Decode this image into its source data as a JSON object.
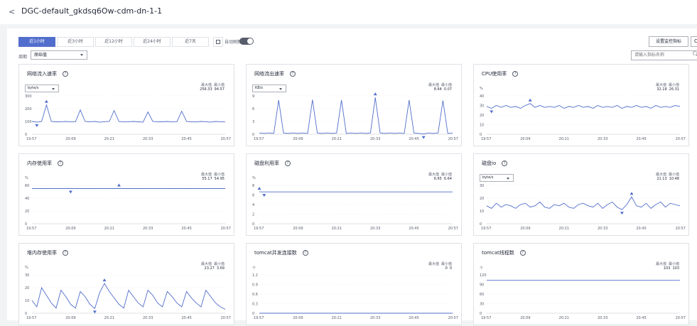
{
  "header": {
    "back": "<",
    "title": "DGC-default_gkdsq6Ow-cdm-dn-1-1"
  },
  "toolbar": {
    "tabs": [
      "近1小时",
      "近3小时",
      "近12小时",
      "近24小时",
      "近7天"
    ],
    "active_tab": 0,
    "auto_refresh_label": "自动刷新",
    "auto_refresh_on": false,
    "settings_label": "设置监控指标",
    "edge_label": "C",
    "period_label": "周期",
    "period_value": "原始值",
    "search_placeholder": "请输入指标名称"
  },
  "cards": [
    {
      "title": "网络流入速率",
      "unit_select": "byte/s",
      "unit_text": "",
      "max_label": "最大值",
      "min_label": "最小值",
      "max": "256.33",
      "min": "94.57"
    },
    {
      "title": "网络流出速率",
      "unit_select": "KB/s",
      "unit_text": "",
      "max_label": "最大值",
      "min_label": "最小值",
      "max": "8.64",
      "min": "0.07"
    },
    {
      "title": "CPU使用率",
      "unit_select": "",
      "unit_text": "%",
      "max_label": "最大值",
      "min_label": "最小值",
      "max": "32.18",
      "min": "26.31"
    },
    {
      "title": "内存使用率",
      "unit_select": "",
      "unit_text": "%",
      "max_label": "最大值",
      "min_label": "最小值",
      "max": "55.17",
      "min": "54.95"
    },
    {
      "title": "磁盘利用率",
      "unit_select": "",
      "unit_text": "%",
      "max_label": "最大值",
      "min_label": "最小值",
      "max": "6.65",
      "min": "6.64"
    },
    {
      "title": "磁盘io",
      "unit_select": "byte/s",
      "unit_text": "",
      "max_label": "最大值",
      "min_label": "最小值",
      "max": "21.13",
      "min": "10.48"
    },
    {
      "title": "堆内存使用率",
      "unit_select": "",
      "unit_text": "%",
      "max_label": "最大值",
      "min_label": "最小值",
      "max": "23.27",
      "min": "3.69"
    },
    {
      "title": "tomcat并发连接数",
      "unit_select": "",
      "unit_text": "个",
      "max_label": "最大值",
      "min_label": "最小值",
      "max": "0",
      "min": "0"
    },
    {
      "title": "tomcat线程数",
      "unit_select": "",
      "unit_text": "个",
      "max_label": "最大值",
      "min_label": "最小值",
      "max": "103",
      "min": "103"
    }
  ],
  "chart_data": [
    {
      "type": "line",
      "title": "网络流入速率",
      "x": [
        "19:57",
        "20:09",
        "20:21",
        "20:33",
        "20:45",
        "20:57"
      ],
      "yticks": [
        0,
        100,
        200,
        300
      ],
      "ylim": [
        0,
        300
      ],
      "values": [
        100,
        95,
        100,
        230,
        100,
        97,
        98,
        100,
        96,
        98,
        190,
        100,
        97,
        100,
        95,
        98,
        100,
        185,
        100,
        96,
        98,
        100,
        97,
        95,
        175,
        100,
        98,
        97,
        100,
        96,
        98,
        180,
        100,
        97,
        96,
        100,
        98,
        95,
        100,
        98,
        96
      ],
      "max_index": 3,
      "min_index": 1,
      "color": "#526ecc"
    },
    {
      "type": "line",
      "title": "网络流出速率",
      "x": [
        "19:57",
        "20:09",
        "20:21",
        "20:33",
        "20:45",
        "20:57"
      ],
      "yticks": [
        0,
        3,
        6,
        9
      ],
      "ylim": [
        0,
        9
      ],
      "values": [
        0.3,
        0.2,
        0.3,
        0.2,
        8.0,
        0.3,
        0.2,
        0.3,
        0.2,
        0.3,
        0.2,
        8.1,
        0.3,
        0.2,
        0.3,
        0.2,
        0.3,
        8.0,
        0.2,
        0.3,
        0.2,
        0.3,
        0.2,
        0.3,
        8.64,
        0.3,
        0.2,
        0.3,
        0.2,
        0.3,
        0.2,
        8.0,
        0.3,
        0.2,
        0.07,
        0.3,
        0.2,
        0.3,
        7.9,
        0.2,
        0.3
      ],
      "max_index": 24,
      "min_index": 34,
      "color": "#526ecc"
    },
    {
      "type": "line",
      "title": "CPU使用率",
      "x": [
        "19:57",
        "20:09",
        "20:21",
        "20:33",
        "20:45",
        "20:57"
      ],
      "yticks": [
        0,
        10,
        20,
        30,
        40
      ],
      "ylim": [
        0,
        40
      ],
      "values": [
        29,
        27,
        30,
        28,
        30,
        28,
        29,
        27,
        30,
        32,
        28,
        30,
        28,
        29,
        28,
        30,
        27,
        29,
        28,
        30,
        28,
        29,
        27,
        30,
        28,
        29,
        28,
        30,
        27,
        29,
        28,
        30,
        28,
        29,
        27,
        30,
        28,
        29,
        28,
        30,
        29
      ],
      "max_index": 9,
      "min_index": 1,
      "color": "#526ecc"
    },
    {
      "type": "line",
      "title": "内存使用率",
      "x": [
        "19:57",
        "20:09",
        "20:21",
        "20:33",
        "20:45",
        "20:57"
      ],
      "yticks": [
        0,
        20,
        40,
        60
      ],
      "ylim": [
        0,
        60
      ],
      "values": [
        55,
        55,
        55,
        55,
        55,
        55,
        55,
        55,
        55,
        55,
        55,
        55,
        55,
        55,
        55,
        55,
        55,
        55,
        55,
        55,
        55,
        55,
        55,
        55,
        55,
        55,
        55,
        55,
        55,
        55,
        55,
        55,
        55,
        55,
        55,
        55,
        55,
        55,
        55,
        55,
        55
      ],
      "max_index": 18,
      "min_index": 8,
      "color": "#526ecc"
    },
    {
      "type": "line",
      "title": "磁盘利用率",
      "x": [
        "19:57",
        "20:09",
        "20:21",
        "20:33",
        "20:45",
        "20:57"
      ],
      "yticks": [
        0,
        2,
        4,
        6,
        8
      ],
      "ylim": [
        0,
        8
      ],
      "values": [
        6.65,
        6.64,
        6.64,
        6.64,
        6.64,
        6.64,
        6.64,
        6.64,
        6.64,
        6.64,
        6.64,
        6.64,
        6.64,
        6.64,
        6.64,
        6.64,
        6.64,
        6.64,
        6.64,
        6.64,
        6.64,
        6.64,
        6.64,
        6.64,
        6.64,
        6.64,
        6.64,
        6.64,
        6.64,
        6.64,
        6.64,
        6.64,
        6.64,
        6.64,
        6.64,
        6.64,
        6.64,
        6.64,
        6.64,
        6.64,
        6.64
      ],
      "max_index": 0,
      "min_index": 1,
      "color": "#526ecc"
    },
    {
      "type": "line",
      "title": "磁盘io",
      "x": [
        "19:57",
        "20:09",
        "20:21",
        "20:33",
        "20:45",
        "20:57"
      ],
      "yticks": [
        0,
        10,
        20,
        30
      ],
      "ylim": [
        0,
        30
      ],
      "values": [
        14,
        12,
        16,
        13,
        15,
        14,
        12,
        15,
        16,
        13,
        14,
        17,
        13,
        12,
        15,
        14,
        16,
        13,
        12,
        15,
        16,
        14,
        13,
        16,
        12,
        15,
        17,
        13,
        11,
        15,
        21,
        14,
        13,
        16,
        12,
        15,
        17,
        13,
        16,
        15,
        14
      ],
      "max_index": 30,
      "min_index": 28,
      "color": "#526ecc"
    },
    {
      "type": "line",
      "title": "堆内存使用率",
      "x": [
        "19:57",
        "20:09",
        "20:21",
        "20:33",
        "20:45",
        "20:57"
      ],
      "yticks": [
        0,
        10,
        20,
        30
      ],
      "ylim": [
        0,
        30
      ],
      "values": [
        10,
        5,
        20,
        14,
        8,
        4,
        18,
        13,
        7,
        4,
        17,
        13,
        7,
        3.69,
        16,
        23.27,
        17,
        12,
        7,
        4,
        18,
        13,
        8,
        5,
        18,
        14,
        8,
        5,
        17,
        13,
        8,
        5,
        17,
        12,
        8,
        5,
        18,
        13,
        8,
        5,
        3
      ],
      "max_index": 15,
      "min_index": 13,
      "color": "#526ecc"
    },
    {
      "type": "line",
      "title": "tomcat并发连接数",
      "x": [
        "19:57",
        "20:09",
        "20:21",
        "20:33",
        "20:45",
        "20:57"
      ],
      "yticks": [
        0,
        0.3,
        0.6,
        0.9,
        1.2
      ],
      "ylim": [
        0,
        1.2
      ],
      "values": [
        0,
        0,
        0,
        0,
        0,
        0,
        0,
        0,
        0,
        0,
        0,
        0,
        0,
        0,
        0,
        0,
        0,
        0,
        0,
        0,
        0,
        0,
        0,
        0,
        0,
        0,
        0,
        0,
        0,
        0,
        0,
        0,
        0,
        0,
        0,
        0,
        0,
        0,
        0,
        0,
        0
      ],
      "max_index": -1,
      "min_index": -1,
      "color": "#526ecc"
    },
    {
      "type": "line",
      "title": "tomcat线程数",
      "x": [
        "19:57",
        "20:09",
        "20:21",
        "20:33",
        "20:45",
        "20:57"
      ],
      "yticks": [
        0,
        30,
        60,
        90,
        120
      ],
      "ylim": [
        0,
        120
      ],
      "values": [
        103,
        103,
        103,
        103,
        103,
        103,
        103,
        103,
        103,
        103,
        103,
        103,
        103,
        103,
        103,
        103,
        103,
        103,
        103,
        103,
        103,
        103,
        103,
        103,
        103,
        103,
        103,
        103,
        103,
        103,
        103,
        103,
        103,
        103,
        103,
        103,
        103,
        103,
        103,
        103,
        103
      ],
      "max_index": -1,
      "min_index": -1,
      "color": "#526ecc"
    }
  ]
}
